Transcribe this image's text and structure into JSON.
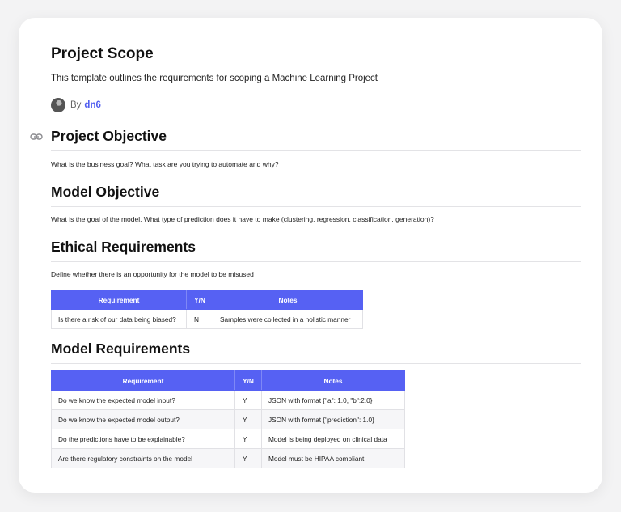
{
  "page": {
    "title": "Project Scope",
    "subtitle": "This template outlines the requirements for scoping a Machine Learning Project",
    "by_label": "By",
    "author": "dn6"
  },
  "sections": {
    "project_objective": {
      "heading": "Project Objective",
      "text": "What is the business goal? What task are you trying to automate and why?"
    },
    "model_objective": {
      "heading": "Model Objective",
      "text": "What is the goal of the model. What type of prediction does it have to make (clustering, regression, classification, generation)?"
    },
    "ethical_requirements": {
      "heading": "Ethical Requirements",
      "text": "Define whether there is an opportunity for the model to be misused",
      "table": {
        "headers": [
          "Requirement",
          "Y/N",
          "Notes"
        ],
        "rows": [
          [
            "Is there a risk of our data being biased?",
            "N",
            "Samples were collected in a holistic manner"
          ]
        ]
      }
    },
    "model_requirements": {
      "heading": "Model Requirements",
      "table": {
        "headers": [
          "Requirement",
          "Y/N",
          "Notes"
        ],
        "rows": [
          [
            "Do we know the expected model input?",
            "Y",
            "JSON with format {\"a\": 1.0, \"b\":2.0}"
          ],
          [
            "Do we know the expected model output?",
            "Y",
            "JSON with format {\"prediction\": 1.0}"
          ],
          [
            "Do the predictions have to be explainable?",
            "Y",
            "Model is being deployed on clinical data"
          ],
          [
            "Are there regulatory constraints on the model",
            "Y",
            "Model must be HIPAA compliant"
          ]
        ]
      }
    }
  },
  "colors": {
    "table_header": "#5661f3",
    "author_link": "#4f5cf0"
  },
  "icons": {
    "anchor": "link-icon"
  }
}
